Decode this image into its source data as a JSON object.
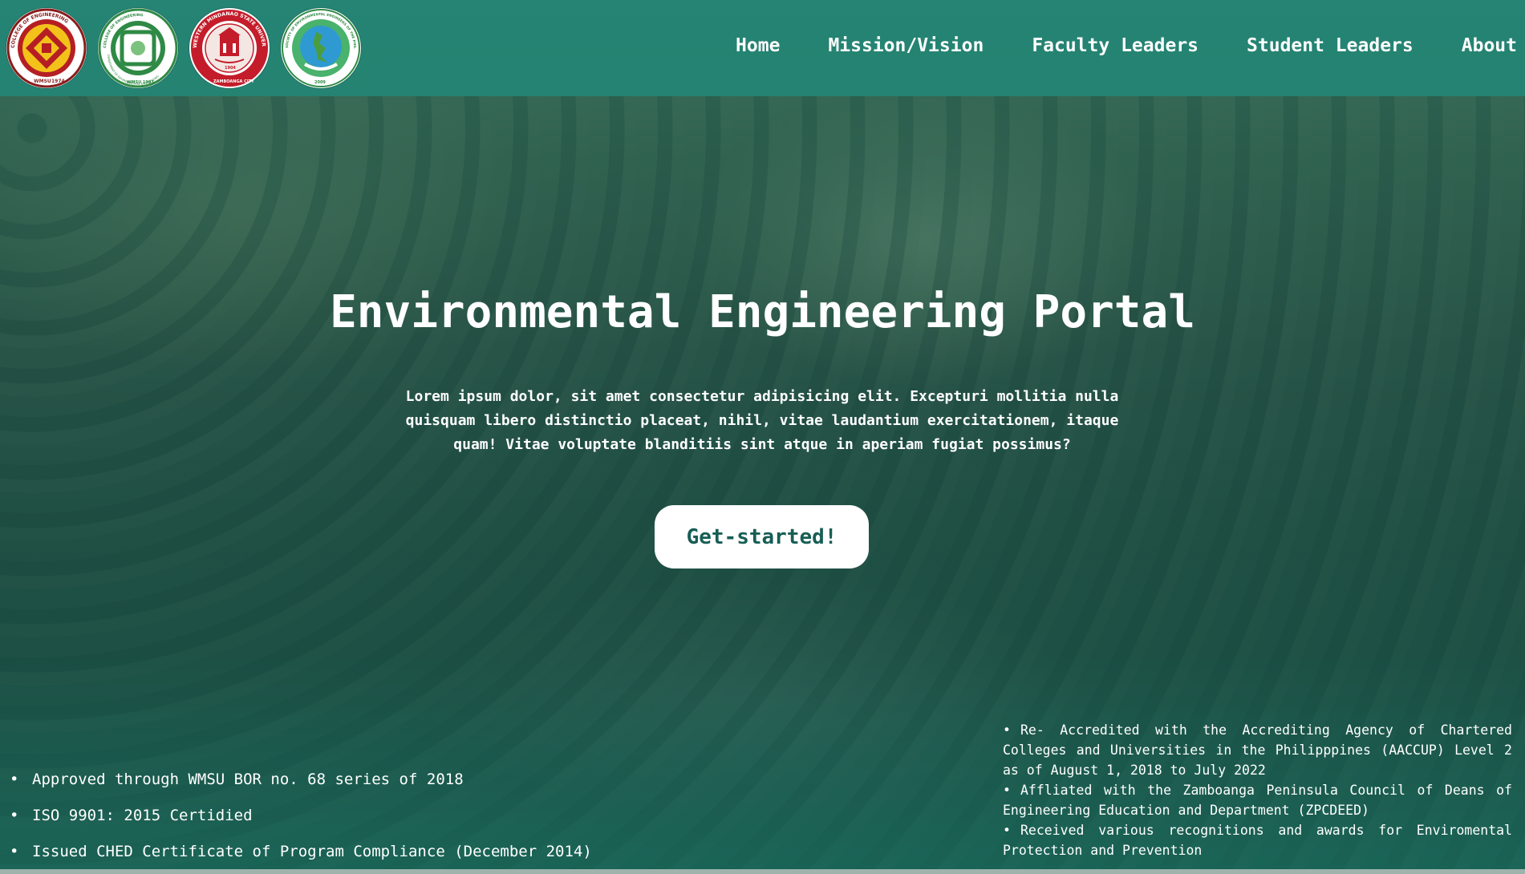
{
  "nav": {
    "logos": [
      {
        "icon": "college-of-engineering-seal-icon",
        "lines": [
          "COLLEGE OF ENGINEERING",
          "WMSU",
          "1974"
        ]
      },
      {
        "icon": "environmental-engineering-department-seal-icon",
        "lines": [
          "COLLEGE OF ENGINEERING",
          "DEPARTMENT OF ENVIRONMENTAL ENGINEERING",
          "WMSU 1997"
        ]
      },
      {
        "icon": "wmsu-university-seal-icon",
        "lines": [
          "WESTERN MINDANAO STATE UNIVERSITY",
          "1904",
          "ZAMBOANGA CITY"
        ]
      },
      {
        "icon": "environmental-engineers-society-seal-icon",
        "lines": [
          "SOCIETY OF ENVIRONMENTAL ENGINEERS OF THE PHILIPPINES",
          "2009"
        ]
      }
    ],
    "links": [
      {
        "label": "Home"
      },
      {
        "label": "Mission/Vision"
      },
      {
        "label": "Faculty Leaders"
      },
      {
        "label": "Student Leaders"
      },
      {
        "label": "About"
      }
    ]
  },
  "hero": {
    "title": "Environmental Engineering Portal",
    "subtitle": "Lorem ipsum dolor, sit amet consectetur adipisicing elit. Excepturi mollitia nulla quisquam libero distinctio placeat, nihil, vitae laudantium exercitationem, itaque quam! Vitae voluptate blanditiis sint atque in aperiam fugiat possimus?",
    "cta_label": "Get-started!"
  },
  "accreditations_left": [
    {
      "bullet": "•",
      "text": "Approved through WMSU BOR no. 68 series of 2018"
    },
    {
      "bullet": "•",
      "text": "ISO 9901: 2015 Certidied"
    },
    {
      "bullet": "•",
      "text": "Issued CHED Certificate of Program Compliance (December 2014)"
    }
  ],
  "accreditations_right": [
    {
      "bullet": "•",
      "text": "Re- Accredited with the Accrediting Agency of Chartered Colleges and Universities in the Philipppines (AACCUP) Level 2 as of August 1, 2018 to July 2022"
    },
    {
      "bullet": "•",
      "text": "Affliated with the Zamboanga Peninsula Council of Deans of Engineering Education and Department (ZPCDEED)"
    },
    {
      "bullet": "•",
      "text": "Received various recognitions and awards for Enviromental Protection and Prevention"
    }
  ],
  "colors": {
    "navbar": "#228676",
    "cta_text": "#175e55",
    "text": "#ffffff"
  }
}
